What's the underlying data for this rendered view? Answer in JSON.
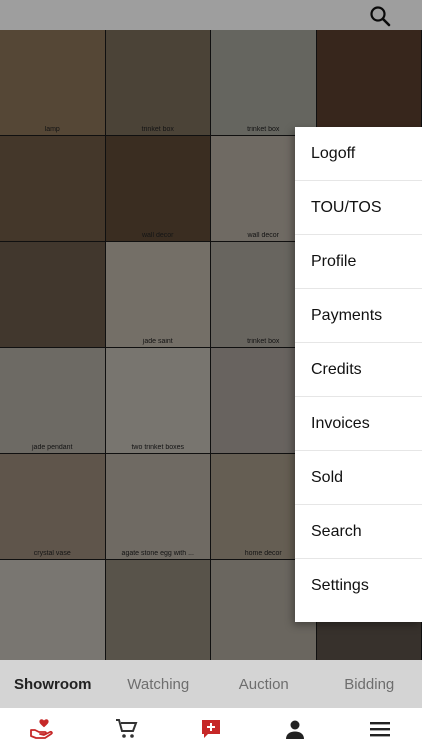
{
  "app": {
    "accent": "#c62828"
  },
  "topbar": {
    "search_icon": "search-icon"
  },
  "grid": {
    "tiles": [
      {
        "caption": "lamp",
        "bg": "#8a7358"
      },
      {
        "caption": "trinket box",
        "bg": "#7a6c5a"
      },
      {
        "caption": "trinket box",
        "bg": "#a3a39a"
      },
      {
        "caption": "",
        "bg": "#5a3e2e"
      },
      {
        "caption": "",
        "bg": "#6e5a44"
      },
      {
        "caption": "wall decor",
        "bg": "#5e4a36"
      },
      {
        "caption": "wall decor",
        "bg": "#b4aca0"
      },
      {
        "caption": "",
        "bg": "#7a6656"
      },
      {
        "caption": "",
        "bg": "#6a5a4a"
      },
      {
        "caption": "jade saint",
        "bg": "#bcb3a6"
      },
      {
        "caption": "trinket box",
        "bg": "#a9a39a"
      },
      {
        "caption": "",
        "bg": "#8a8070"
      },
      {
        "caption": "jade pendant",
        "bg": "#b0aba2"
      },
      {
        "caption": "two trinket boxes",
        "bg": "#c2bdb4"
      },
      {
        "caption": "",
        "bg": "#a8a09a"
      },
      {
        "caption": "",
        "bg": "#8a7a6a"
      },
      {
        "caption": "crystal vase",
        "bg": "#9a8a7a"
      },
      {
        "caption": "agate stone egg with ...",
        "bg": "#b3aba0"
      },
      {
        "caption": "home decor",
        "bg": "#a49886"
      },
      {
        "caption": "",
        "bg": "#7a6a5a"
      },
      {
        "caption": "",
        "bg": "#c4bfb6"
      },
      {
        "caption": "",
        "bg": "#8e8678"
      },
      {
        "caption": "",
        "bg": "#aba59a"
      },
      {
        "caption": "",
        "bg": "#5a5048"
      }
    ]
  },
  "menu": {
    "items": [
      "Logoff",
      "TOU/TOS",
      "Profile",
      "Payments",
      "Credits",
      "Invoices",
      "Sold",
      "Search",
      "Settings"
    ]
  },
  "tabs": [
    {
      "label": "Showroom",
      "active": true
    },
    {
      "label": "Watching",
      "active": false
    },
    {
      "label": "Auction",
      "active": false
    },
    {
      "label": "Bidding",
      "active": false
    }
  ],
  "bottom_nav": [
    "hand-heart-icon",
    "cart-icon",
    "add-listing-icon",
    "person-icon",
    "menu-icon"
  ]
}
